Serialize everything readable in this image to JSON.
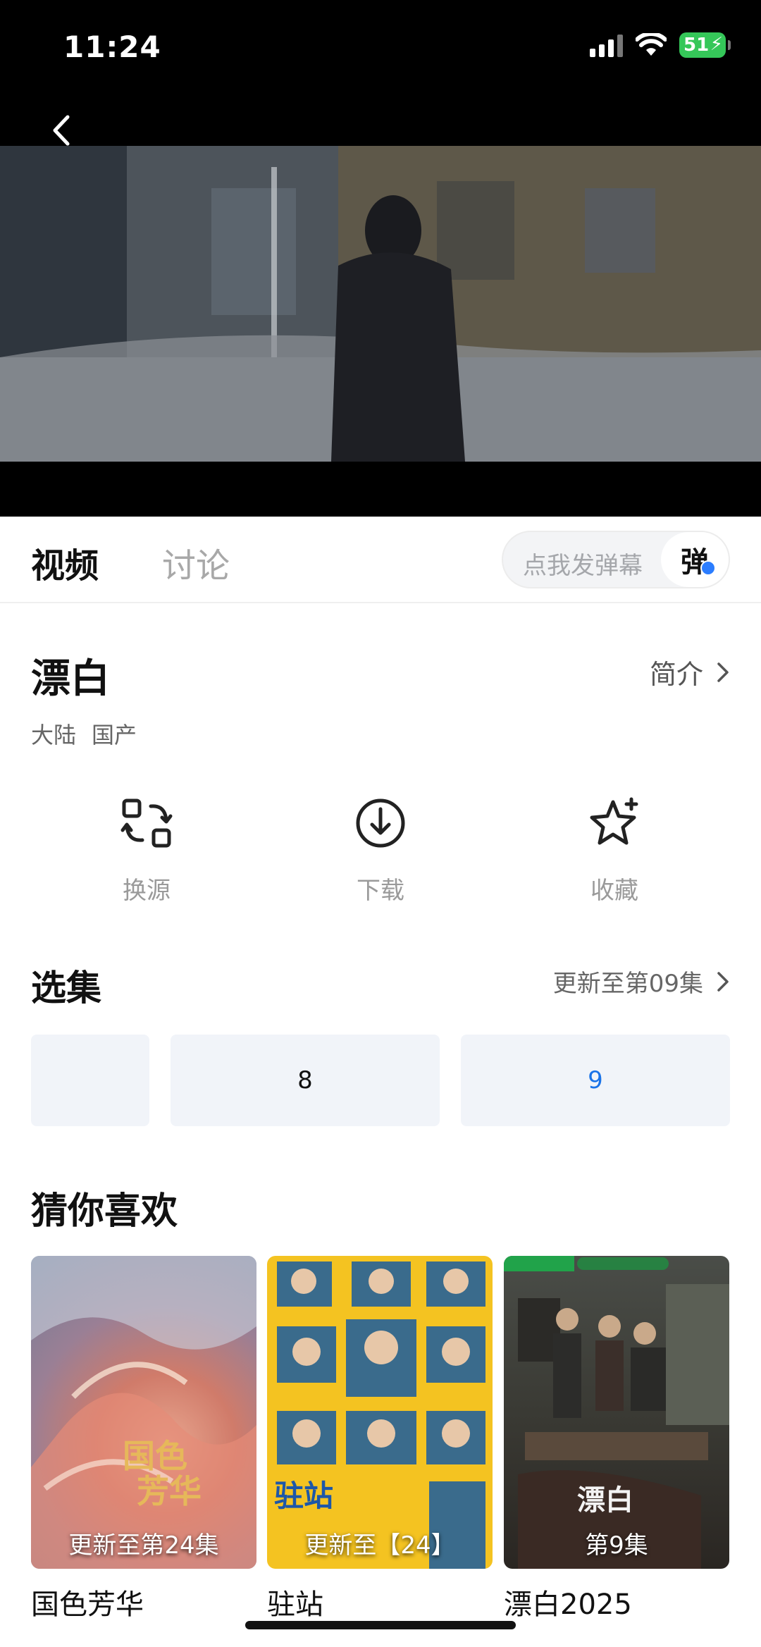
{
  "status_bar": {
    "time": "11:24",
    "battery": "51"
  },
  "tabs": {
    "video": "视频",
    "discussion": "讨论"
  },
  "danmu": {
    "placeholder": "点我发弹幕",
    "button": "弹"
  },
  "show": {
    "title": "漂白",
    "intro": "简介",
    "tags": [
      "大陆",
      "国产"
    ]
  },
  "actions": [
    {
      "label": "换源",
      "icon": "switch-source-icon"
    },
    {
      "label": "下载",
      "icon": "download-icon"
    },
    {
      "label": "收藏",
      "icon": "favorite-star-icon"
    }
  ],
  "episodes": {
    "title": "选集",
    "update_text": "更新至第09集",
    "items": [
      "",
      "8",
      "9"
    ],
    "active": "9"
  },
  "recommend": {
    "title": "猜你喜欢",
    "items": [
      {
        "name": "国色芳华",
        "badge": "更新至第24集"
      },
      {
        "name": "驻站",
        "badge": "更新至【24】"
      },
      {
        "name": "漂白2025",
        "badge": "第9集"
      }
    ]
  },
  "colors": {
    "accent": "#1a73e8",
    "battery": "#35c759"
  }
}
